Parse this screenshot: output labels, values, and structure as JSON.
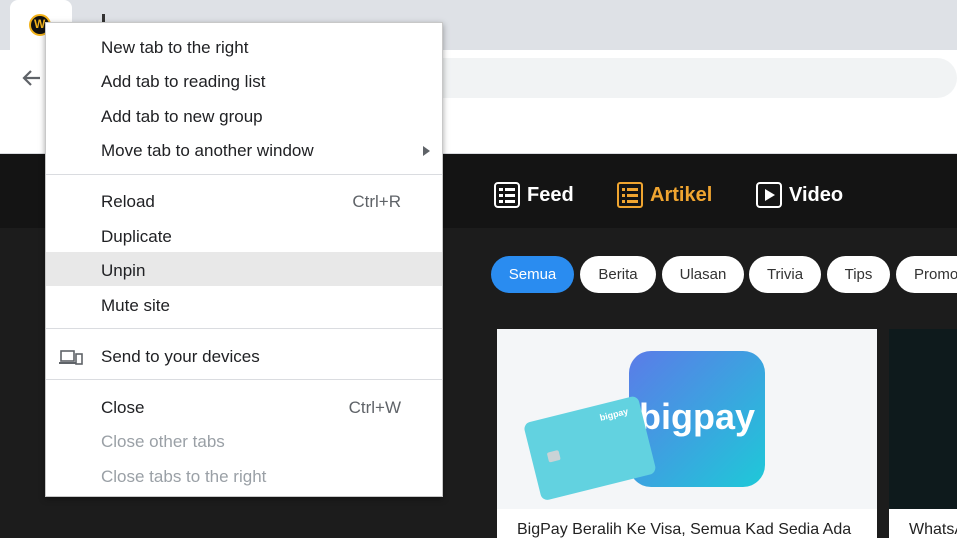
{
  "context_menu": {
    "items": [
      {
        "label": "New tab to the right"
      },
      {
        "label": "Add tab to reading list"
      },
      {
        "label": "Add tab to new group"
      },
      {
        "label": "Move tab to another window"
      },
      {
        "label": "Reload",
        "shortcut": "Ctrl+R"
      },
      {
        "label": "Duplicate"
      },
      {
        "label": "Unpin"
      },
      {
        "label": "Mute site"
      },
      {
        "label": "Send to your devices"
      },
      {
        "label": "Close",
        "shortcut": "Ctrl+W"
      },
      {
        "label": "Close other tabs"
      },
      {
        "label": "Close tabs to the right"
      }
    ]
  },
  "site_nav": {
    "feed": "Feed",
    "artikel": "Artikel",
    "video": "Video",
    "active_color": "#f0a530"
  },
  "categories": [
    "Semua",
    "Berita",
    "Ulasan",
    "Trivia",
    "Tips",
    "Promo"
  ],
  "cards": [
    {
      "title": "BigPay Beralih Ke Visa, Semua Kad Sedia Ada",
      "logo_text": "bigpay"
    },
    {
      "title": "WhatsApp"
    }
  ],
  "colors": {
    "accent": "#2a8cf0",
    "brand": "#f0a530"
  }
}
